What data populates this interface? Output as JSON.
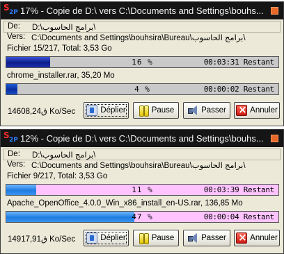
{
  "windows": [
    {
      "app_icon_glyph": "S",
      "app_icon_sub": "2P",
      "title": "17% - Copie de D:\\ vers C:\\Documents and Settings\\bouhs...",
      "from_label": "De:",
      "from_path": "D:\\برامج الحاسوب\\",
      "to_label": "Vers:",
      "to_path": "C:\\Documents and Settings\\bouhsira\\Bureau\\برامج الحاسوب\\",
      "file_info": "Fichier 15/217, Total: 3,53 Go",
      "total_progress": {
        "percent_text": "16 %",
        "fraction": 0.16,
        "remaining": "00:03:31 Restant"
      },
      "current_file": "chrome_installer.rar, 35,20 Mo",
      "file_progress": {
        "percent_text": "4 %",
        "fraction": 0.04,
        "remaining": "00:00:02 Restant"
      },
      "speed": "14ق608,24 Ko/Sec",
      "buttons": {
        "unfold": "Déplier",
        "pause": "Pause",
        "skip": "Passer",
        "cancel": "Annuler"
      }
    },
    {
      "app_icon_glyph": "S",
      "app_icon_sub": "2P",
      "title": "12% - Copie de D:\\ vers C:\\Documents and Settings\\bouhs...",
      "from_label": "De:",
      "from_path": "D:\\برامج الحاسوب\\",
      "to_label": "Vers:",
      "to_path": "C:\\Documents and Settings\\bouhsira\\Bureau\\برامج الحاسوب\\",
      "file_info": "Fichier 9/217, Total: 3,53 Go",
      "total_progress": {
        "percent_text": "11 %",
        "fraction": 0.11,
        "remaining": "00:03:39 Restant"
      },
      "current_file": "Apache_OpenOffice_4.0.0_Win_x86_install_en-US.rar, 136,85 Mo",
      "file_progress": {
        "percent_text": "47 %",
        "fraction": 0.47,
        "remaining": "00:00:04 Restant"
      },
      "speed": "14ق917,91 Ko/Sec",
      "buttons": {
        "unfold": "Déplier",
        "pause": "Pause",
        "skip": "Passer",
        "cancel": "Annuler"
      }
    }
  ],
  "colors": {
    "title_bar": "#151515",
    "window_bg": "#ece9d8",
    "progress_fill_1": "#0d1e8a",
    "progress_fill_2": "#1f7ce0",
    "progress_track_2": "#ffc4ff"
  }
}
